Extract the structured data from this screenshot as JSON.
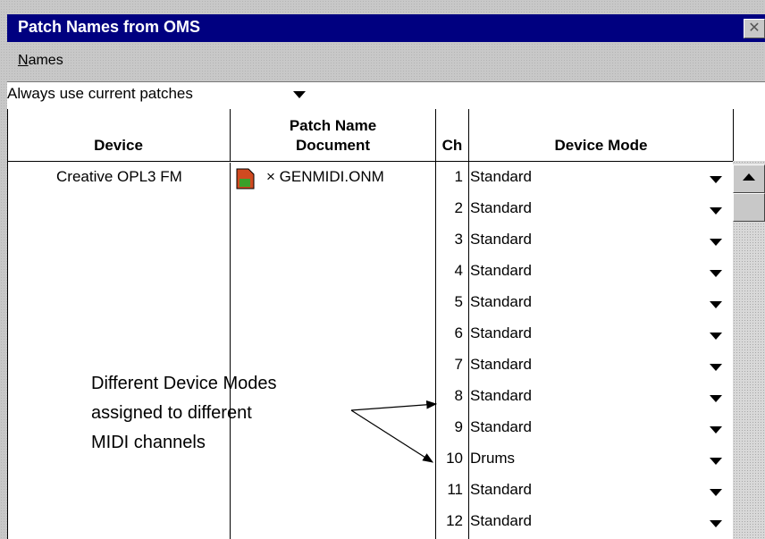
{
  "window": {
    "title": "Patch Names from OMS",
    "close_label": "✕"
  },
  "menu": {
    "names_underline": "N",
    "names_rest": "ames"
  },
  "dropdown": {
    "value": "Always use current patches"
  },
  "columns": {
    "device": "Device",
    "patch_line1": "Patch Name",
    "patch_line2": "Document",
    "ch": "Ch",
    "mode": "Device Mode"
  },
  "device": {
    "name": "Creative OPL3 FM",
    "patch_doc": "× GENMIDI.ONM",
    "icon": "document-icon"
  },
  "channels": [
    {
      "ch": "1",
      "mode": "Standard"
    },
    {
      "ch": "2",
      "mode": "Standard"
    },
    {
      "ch": "3",
      "mode": "Standard"
    },
    {
      "ch": "4",
      "mode": "Standard"
    },
    {
      "ch": "5",
      "mode": "Standard"
    },
    {
      "ch": "6",
      "mode": "Standard"
    },
    {
      "ch": "7",
      "mode": "Standard"
    },
    {
      "ch": "8",
      "mode": "Standard"
    },
    {
      "ch": "9",
      "mode": "Standard"
    },
    {
      "ch": "10",
      "mode": "Drums"
    },
    {
      "ch": "11",
      "mode": "Standard"
    },
    {
      "ch": "12",
      "mode": "Standard"
    }
  ],
  "annotation": {
    "line1": "Different Device Modes",
    "line2": "assigned to different",
    "line3": "MIDI channels"
  }
}
